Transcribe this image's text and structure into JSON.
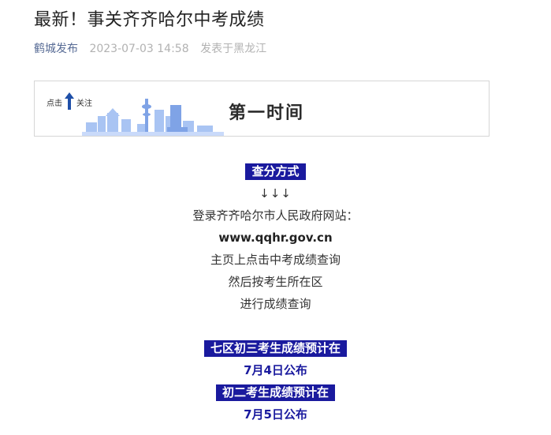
{
  "article": {
    "title": "最新！事关齐齐哈尔中考成绩",
    "account": "鹤城发布",
    "datetime": "2023-07-03 14:58",
    "location": "发表于黑龙江"
  },
  "banner": {
    "click_label": "点击",
    "follow_label": "关注",
    "slogan": "第一时间",
    "arrow_icon": "arrow-up-icon",
    "skyline_color": "#8fb3f0"
  },
  "content": {
    "method_tag": "查分方式",
    "arrows": "↓↓↓",
    "line1": "登录齐齐哈尔市人民政府网站：",
    "url": "www.qqhr.gov.cn",
    "line3": "主页上点击中考成绩查询",
    "line4": "然后按考生所在区",
    "line5": "进行成绩查询",
    "tag2": "七区初三考生成绩预计在",
    "date1": "7月4日公布",
    "tag3": "初二考生成绩预计在",
    "date2": "7月5日公布"
  },
  "colors": {
    "tag_bg": "#1a1a9e",
    "account_link": "#576b95",
    "meta_gray": "#b2b2b2"
  }
}
